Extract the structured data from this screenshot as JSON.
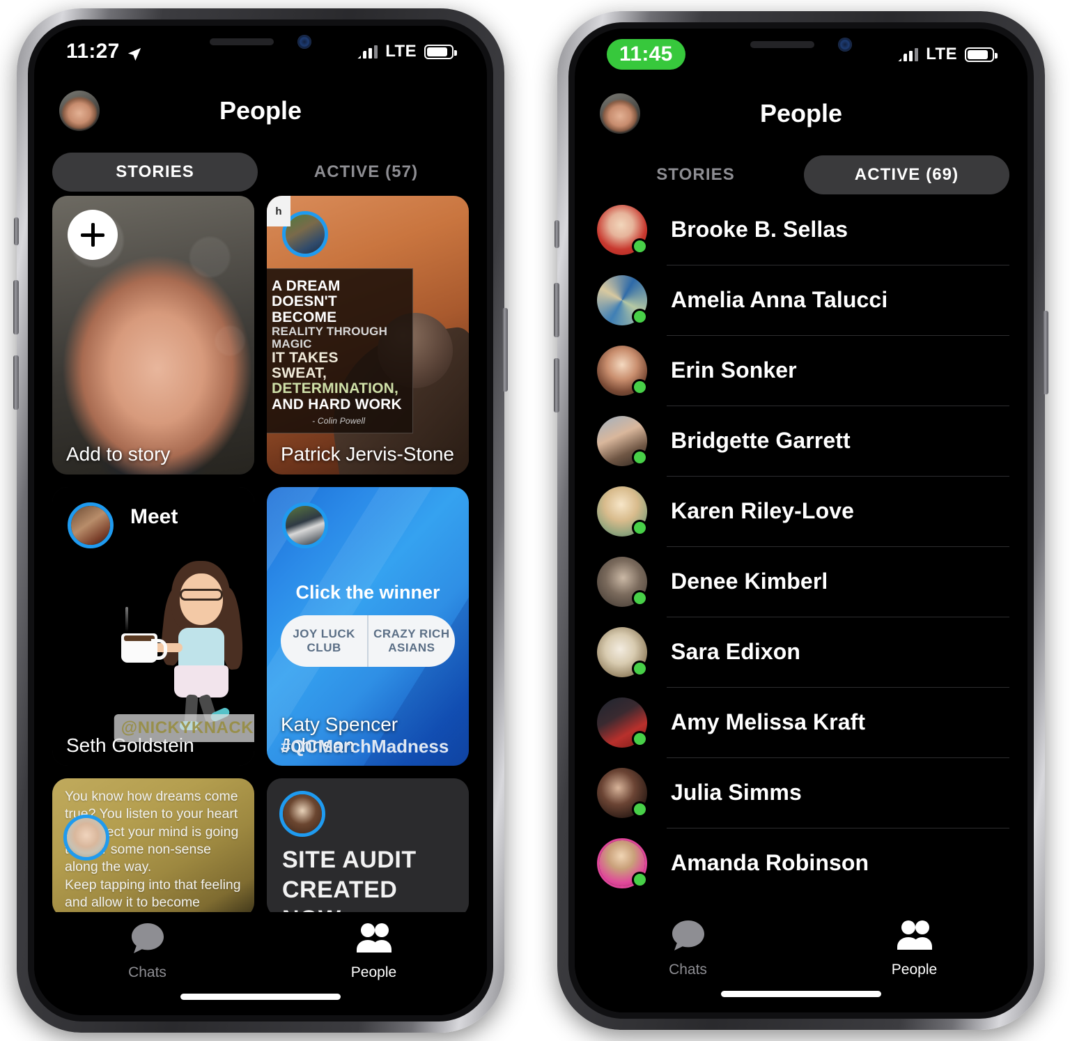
{
  "phones": {
    "left": {
      "status": {
        "time": "11:27",
        "location_icon": "location-arrow-icon",
        "carrier": "LTE",
        "recording": false
      },
      "nav": {
        "title": "People",
        "avatar": "user-avatar"
      },
      "segments": [
        {
          "label": "STORIES",
          "active": true
        },
        {
          "label": "ACTIVE (57)",
          "active": false
        }
      ],
      "stories": [
        {
          "id": "add-to-story",
          "name": "Add to story",
          "kind": "add",
          "corner_tag": ""
        },
        {
          "id": "patrick",
          "name": "Patrick Jervis-Stone",
          "kind": "photo-quote",
          "corner_tag": "h",
          "quote_lines": [
            "A DREAM",
            "DOESN'T BECOME",
            "REALITY THROUGH MAGIC",
            "IT TAKES",
            "SWEAT,",
            "DETERMINATION,",
            "AND HARD WORK"
          ],
          "quote_attrib": "- Colin Powell"
        },
        {
          "id": "seth",
          "name": "Seth Goldstein",
          "kind": "bitmoji",
          "heading": "Meet",
          "tag": "@NICKYKNACKS"
        },
        {
          "id": "katy",
          "name": "Katy Spencer Johnson",
          "kind": "poll",
          "question": "Click the winner",
          "options": [
            "JOY LUCK CLUB",
            "CRAZY RICH ASIANS"
          ],
          "hashtag": "#QCMarchMadness"
        },
        {
          "id": "dreams",
          "name": "",
          "kind": "text",
          "text": "You know how dreams come true? You listen to your heart and direct your mind is going to offer some non-sense along the way.\nKeep tapping into that feeling and allow it to become expansive within you until yo..."
        },
        {
          "id": "site-audit",
          "name": "",
          "kind": "dark-text",
          "text": "SITE AUDIT\nCREATED  NOW"
        }
      ],
      "tabs": [
        {
          "label": "Chats",
          "icon": "chat-bubble-icon",
          "active": false
        },
        {
          "label": "People",
          "icon": "people-icon",
          "active": true
        }
      ]
    },
    "right": {
      "status": {
        "time": "11:45",
        "carrier": "LTE",
        "recording": true
      },
      "nav": {
        "title": "People",
        "avatar": "user-avatar"
      },
      "segments": [
        {
          "label": "STORIES",
          "active": false
        },
        {
          "label": "ACTIVE (69)",
          "active": true
        }
      ],
      "people": [
        {
          "name": "Brooke B. Sellas",
          "online": true,
          "ring": false,
          "avatar": "ph-brooke"
        },
        {
          "name": "Amelia Anna Talucci",
          "online": true,
          "ring": false,
          "avatar": "ph-amelia"
        },
        {
          "name": "Erin Sonker",
          "online": true,
          "ring": false,
          "avatar": "ph-erin"
        },
        {
          "name": "Bridgette Garrett",
          "online": true,
          "ring": false,
          "avatar": "ph-bridgette"
        },
        {
          "name": "Karen Riley-Love",
          "online": true,
          "ring": false,
          "avatar": "ph-karen"
        },
        {
          "name": "Denee Kimberl",
          "online": true,
          "ring": false,
          "avatar": "ph-denee"
        },
        {
          "name": "Sara Edixon",
          "online": true,
          "ring": false,
          "avatar": "ph-sara"
        },
        {
          "name": "Amy Melissa Kraft",
          "online": true,
          "ring": false,
          "avatar": "ph-amy"
        },
        {
          "name": "Julia Simms",
          "online": true,
          "ring": false,
          "avatar": "ph-julia"
        },
        {
          "name": "Amanda Robinson",
          "online": true,
          "ring": true,
          "avatar": "ph-amanda"
        }
      ],
      "tabs": [
        {
          "label": "Chats",
          "icon": "chat-bubble-icon",
          "active": false
        },
        {
          "label": "People",
          "icon": "people-icon",
          "active": true
        }
      ]
    }
  },
  "colors": {
    "accent_blue": "#1f9bf0",
    "online_green": "#48d048",
    "recording_green": "#37c83c",
    "segment_active_bg": "#3a3a3c",
    "inactive_text": "#8e8e93",
    "story_ring_pink": "#e0469a"
  }
}
